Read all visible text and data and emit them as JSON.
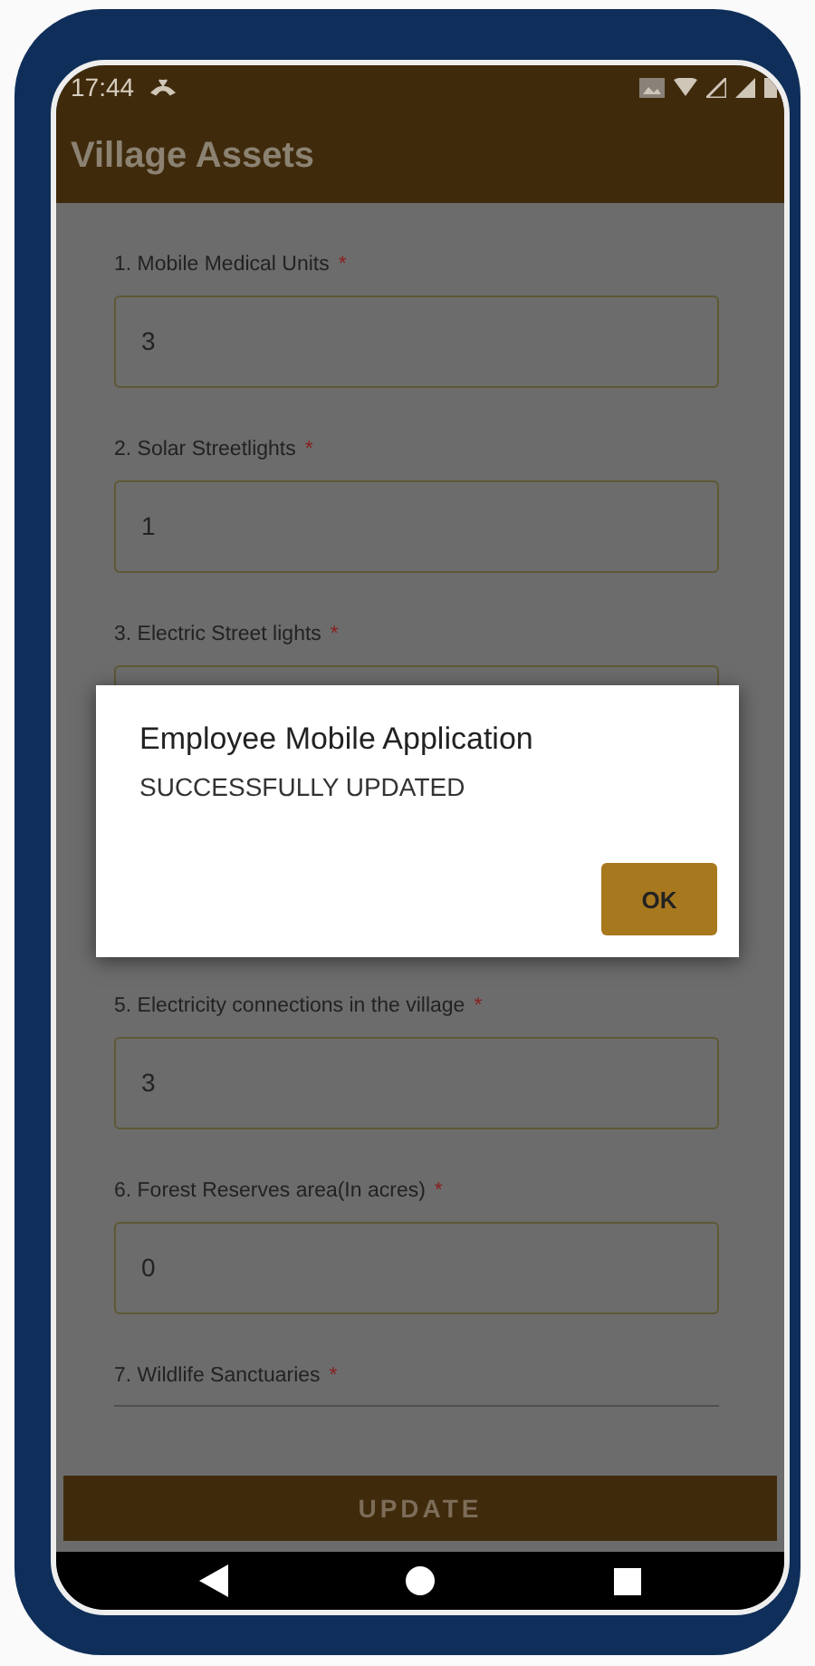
{
  "status_bar": {
    "time": "17:44"
  },
  "app_bar": {
    "title": "Village Assets"
  },
  "fields": [
    {
      "kind": "box",
      "label": "1. Mobile Medical Units",
      "required_mark": "*",
      "value": "3"
    },
    {
      "kind": "box",
      "label": "2. Solar Streetlights",
      "required_mark": "*",
      "value": "1"
    },
    {
      "kind": "box",
      "label": "3. Electric Street lights",
      "required_mark": "*"
    },
    {
      "kind": "hidden"
    },
    {
      "kind": "box",
      "label": "5. Electricity connections in the village",
      "required_mark": "*",
      "value": "3"
    },
    {
      "kind": "box",
      "label": "6. Forest Reserves area(In acres)",
      "required_mark": "*",
      "value": "0"
    },
    {
      "kind": "line",
      "label": "7. Wildlife Sanctuaries",
      "required_mark": "*"
    }
  ],
  "update_button": {
    "label": "UPDATE"
  },
  "dialog": {
    "title": "Employee Mobile Application",
    "message": "SUCCESSFULLY UPDATED",
    "button": "OK"
  }
}
